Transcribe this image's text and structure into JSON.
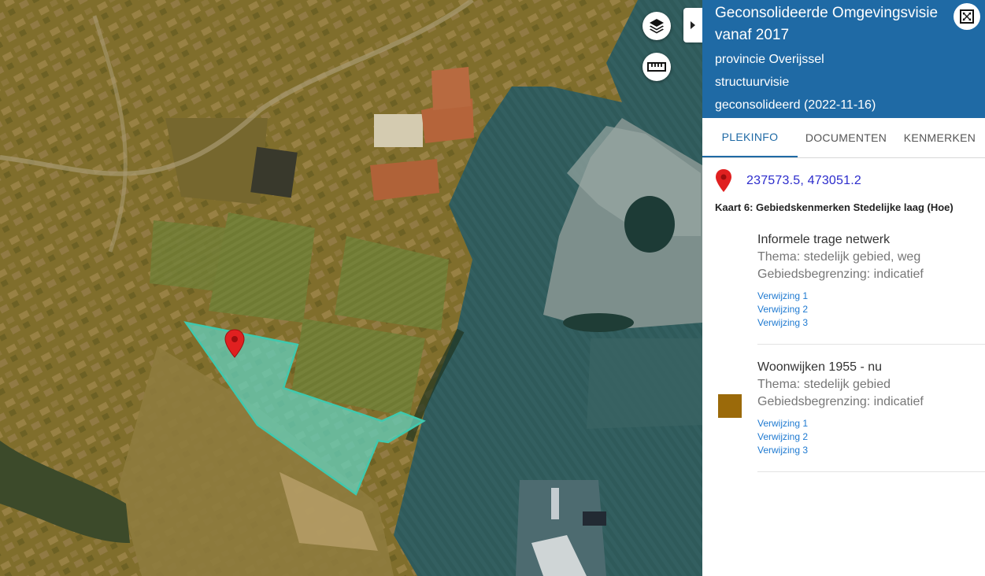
{
  "panel": {
    "title": "Geconsolideerde Omgevingsvisie vanaf 2017",
    "province": "provincie Overijssel",
    "doc_type": "structuurvisie",
    "status": "geconsolideerd (2022-11-16)"
  },
  "tabs": [
    {
      "label": "PLEKINFO"
    },
    {
      "label": "DOCUMENTEN"
    },
    {
      "label": "KENMERKEN"
    }
  ],
  "location": {
    "coordinates": "237573.5, 473051.2"
  },
  "layer_heading": "Kaart 6: Gebiedskenmerken Stedelijke laag (Hoe)",
  "legend_items": [
    {
      "title": "Informele trage netwerk",
      "thema": "Thema: stedelijk gebied, weg",
      "begrenzing": "Gebiedsbegrenzing: indicatief",
      "links": [
        "Verwijzing 1",
        "Verwijzing 2",
        "Verwijzing 3"
      ],
      "swatch_color": ""
    },
    {
      "title": "Woonwijken 1955 - nu",
      "thema": "Thema: stedelijk gebied",
      "begrenzing": "Gebiedsbegrenzing: indicatief",
      "links": [
        "Verwijzing 1",
        "Verwijzing 2",
        "Verwijzing 3"
      ],
      "swatch_color": "#9b6a0a"
    }
  ],
  "colors": {
    "header_blue": "#1f6aa5",
    "selection_fill": "#63d1bd",
    "map_tint_brown": "#8a6f1c",
    "map_overlay_blue": "#2e5e6e",
    "marker_red": "#e02020"
  },
  "icons": {
    "layers": "layers-icon",
    "measure": "ruler-icon",
    "collapse": "chevron-right-icon",
    "fullscreen": "fullscreen-icon",
    "marker": "map-marker-icon"
  }
}
